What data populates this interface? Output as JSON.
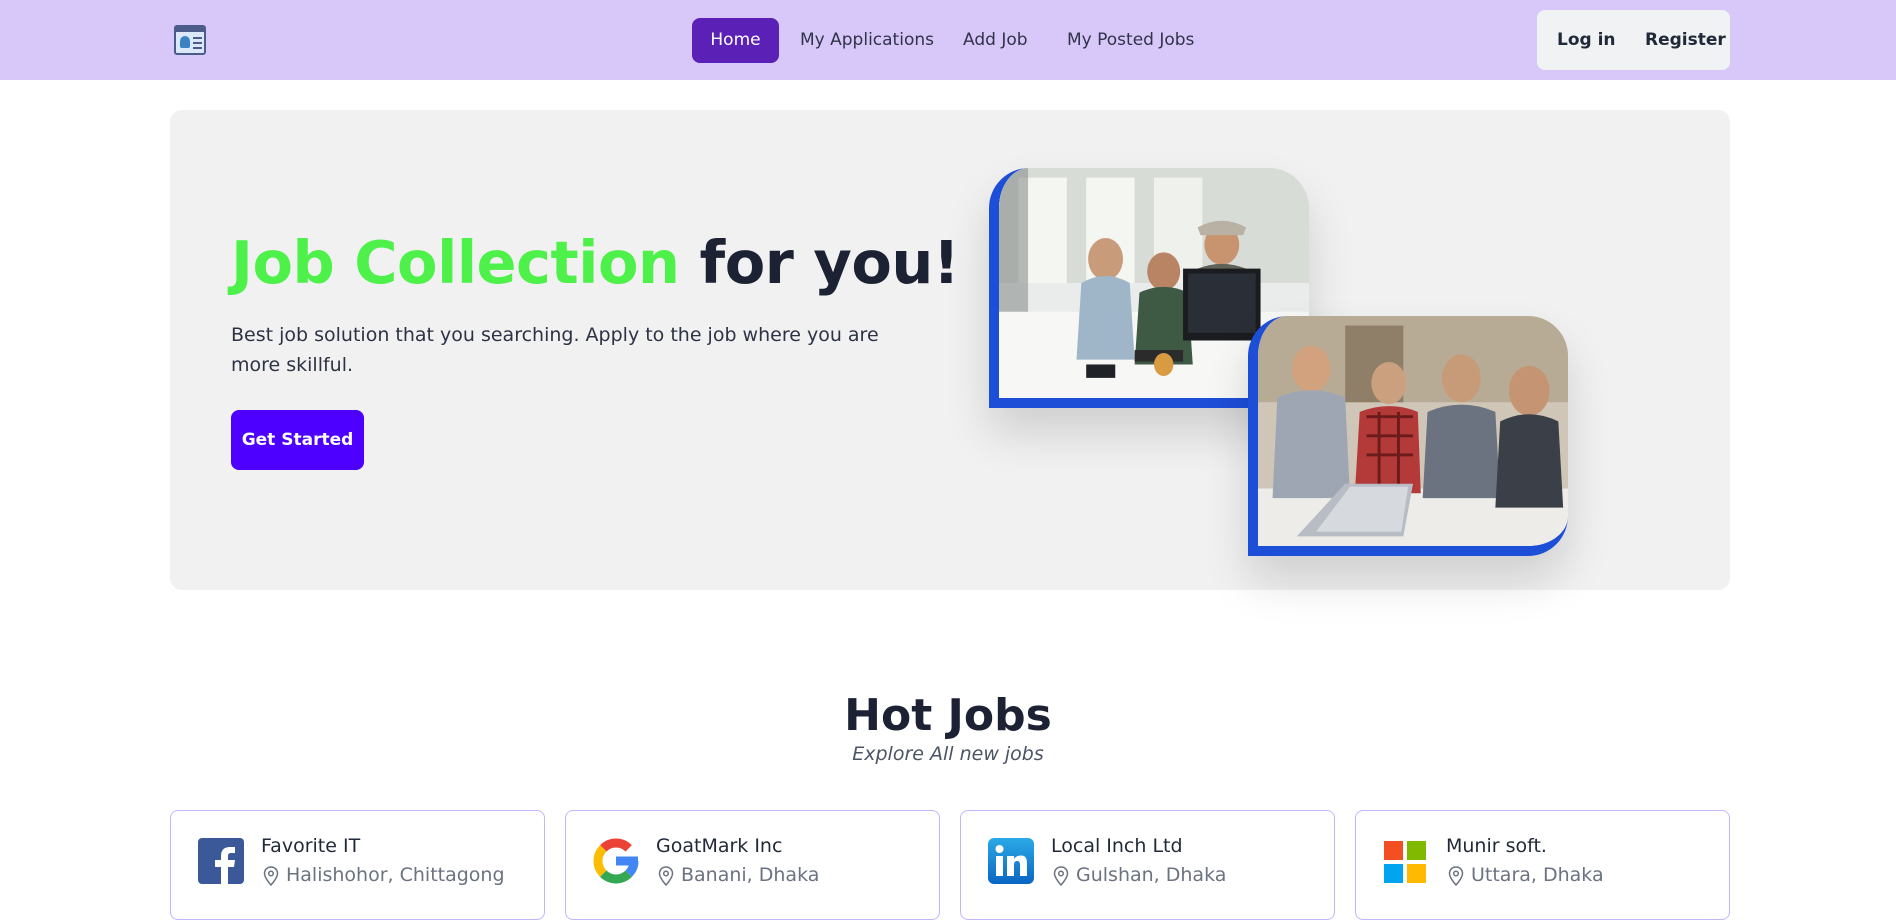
{
  "nav": {
    "links": [
      "Home",
      "My Applications",
      "Add Job",
      "My Posted Jobs"
    ],
    "active": "Home",
    "login_label": "Log in",
    "register_label": "Register"
  },
  "hero": {
    "title_highlight": "Job Collection",
    "title_rest": "for you!",
    "description": "Best job solution that you searching. Apply to the job where you are more skillful.",
    "cta_label": "Get Started"
  },
  "hot_jobs": {
    "title": "Hot Jobs",
    "subtitle": "Explore All new jobs",
    "cards": [
      {
        "company": "Favorite IT",
        "location": "Halishohor, Chittagong",
        "logo_icon": "facebook-logo-icon"
      },
      {
        "company": "GoatMark Inc",
        "location": "Banani, Dhaka",
        "logo_icon": "google-logo-icon"
      },
      {
        "company": "Local Inch Ltd",
        "location": "Gulshan, Dhaka",
        "logo_icon": "linkedin-logo-icon"
      },
      {
        "company": "Munir soft.",
        "location": "Uttara, Dhaka",
        "logo_icon": "microsoft-logo-icon"
      }
    ]
  },
  "colors": {
    "navbar_bg": "#d8c8fa",
    "active_nav": "#5b21b6",
    "title_highlight": "#4ef04a",
    "cta": "#4d00ff",
    "photo_frame": "#1d4ed8",
    "card_border": "#c4b5fd"
  }
}
